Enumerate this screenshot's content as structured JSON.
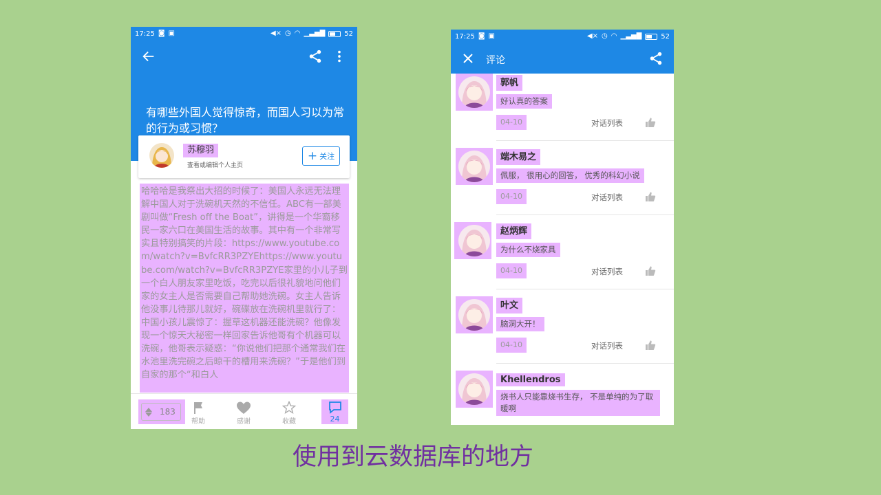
{
  "status_bar": {
    "time": "17:25",
    "battery": "52"
  },
  "answer_screen": {
    "question_title": "有哪些外国人觉得惊奇，而国人习以为常的行为或习惯？",
    "author": {
      "name": "苏穆羽",
      "subtitle": "查看或编辑个人主页"
    },
    "follow_label": "关注",
    "body": "哈哈哈是我祭出大招的时候了：美国人永远无法理解中国人对于洗碗机天然的不信任。ABC有一部美剧叫做“Fresh off the Boat”，讲得是一个华裔移民一家六口在美国生活的故事。其中有一个非常写实且特别搞笑的片段：https://www.youtube.com/watch?v=BvfcRR3PZYEhttps://www.youtube.com/watch?v=BvfcRR3PZYE家里的小儿子到一个白人朋友家里吃饭，吃完以后很礼貌地问他们家的女主人是否需要自己帮助她洗碗。女主人告诉他没事儿待那儿就好，碗碟放在洗碗机里就行了：中国小孩儿震惊了：握草这机器还能洗碗？他像发现一个惊天大秘密一样回家告诉他哥有个机器可以洗碗，他哥表示疑惑：“你说他们把那个通常我们在水池里洗完碗之后晾干的槽用来洗碗？”于是他们到自家的那个“和白人",
    "bottom_bar": {
      "vote_count": "183",
      "help_label": "帮助",
      "thanks_label": "感谢",
      "favorite_label": "收藏",
      "comment_count": "24"
    }
  },
  "comments_screen": {
    "title": "评论",
    "thread_label": "对话列表",
    "comments": [
      {
        "name": "郭帆",
        "text": "好认真的答案",
        "date": "04-10"
      },
      {
        "name": "端木易之",
        "text": "佩服， 很用心的回答， 优秀的科幻小说",
        "date": "04-10"
      },
      {
        "name": "赵炳辉",
        "text": "为什么不烧家具",
        "date": "04-10"
      },
      {
        "name": "叶文",
        "text": "脑洞大开！",
        "date": "04-10"
      },
      {
        "name": "Khellendros",
        "text": "烧书人只能靠烧书生存， 不是单纯的为了取暖啊",
        "date": ""
      }
    ]
  },
  "caption": "使用到云数据库的地方",
  "colors": {
    "background": "#a9d18e",
    "app_blue": "#1e88e5",
    "highlight": "#e096ff",
    "caption": "#7030a0"
  }
}
